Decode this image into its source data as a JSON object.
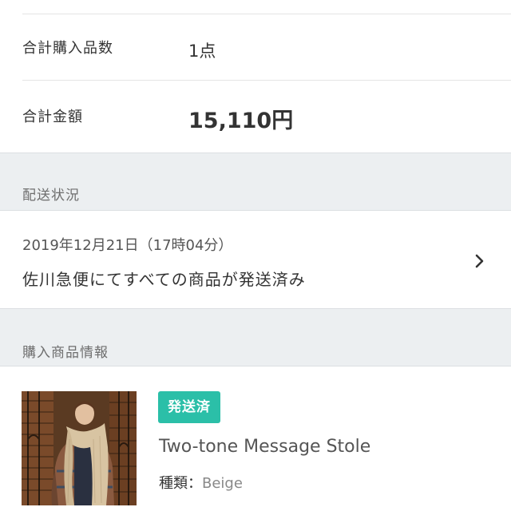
{
  "summary": {
    "count_label": "合計購入品数",
    "count_value": "1点",
    "total_label": "合計金額",
    "total_value": "15,110円"
  },
  "shipping": {
    "section_title": "配送状況",
    "datetime": "2019年12月21日（17時04分）",
    "status": "佐川急便にてすべての商品が発送済み",
    "icon": "chevron-right-icon"
  },
  "items": {
    "section_title": "購入商品情報",
    "list": [
      {
        "badge": "発送済",
        "name": "Two-tone Message Stole",
        "variant_key": "種類",
        "variant_sep": "：",
        "variant_value": "Beige"
      }
    ]
  },
  "colors": {
    "badge_bg": "#2bbfa8",
    "section_bg": "#eceff1",
    "text_primary": "#333333",
    "text_muted": "#888888"
  }
}
